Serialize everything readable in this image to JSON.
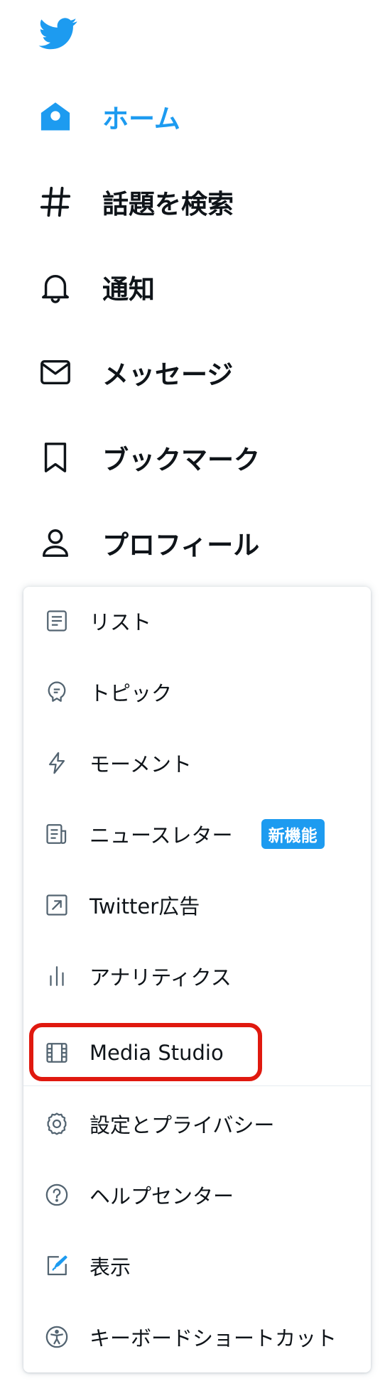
{
  "nav": {
    "logo_icon": "twitter-bird-icon",
    "accent_color": "#1d9bf0",
    "items": [
      {
        "label": "ホーム",
        "icon": "home-icon",
        "active": true
      },
      {
        "label": "話題を検索",
        "icon": "hashtag-icon",
        "active": false
      },
      {
        "label": "通知",
        "icon": "bell-icon",
        "active": false
      },
      {
        "label": "メッセージ",
        "icon": "envelope-icon",
        "active": false
      },
      {
        "label": "ブックマーク",
        "icon": "bookmark-icon",
        "active": false
      },
      {
        "label": "プロフィール",
        "icon": "person-icon",
        "active": false
      }
    ]
  },
  "more_menu": {
    "items": [
      {
        "label": "リスト",
        "icon": "list-icon"
      },
      {
        "label": "トピック",
        "icon": "topic-icon"
      },
      {
        "label": "モーメント",
        "icon": "lightning-icon"
      },
      {
        "label": "ニュースレター",
        "icon": "newsletter-icon",
        "badge": "新機能"
      },
      {
        "label": "Twitter広告",
        "icon": "arrow-up-right-icon"
      },
      {
        "label": "アナリティクス",
        "icon": "analytics-icon"
      },
      {
        "label": "Media Studio",
        "icon": "film-icon",
        "highlighted": true
      },
      {
        "label": "設定とプライバシー",
        "icon": "gear-icon"
      },
      {
        "label": "ヘルプセンター",
        "icon": "help-icon"
      },
      {
        "label": "表示",
        "icon": "display-icon"
      },
      {
        "label": "キーボードショートカット",
        "icon": "accessibility-icon"
      }
    ],
    "badge_color": "#1d9bf0",
    "highlight_color": "#e0190f"
  }
}
